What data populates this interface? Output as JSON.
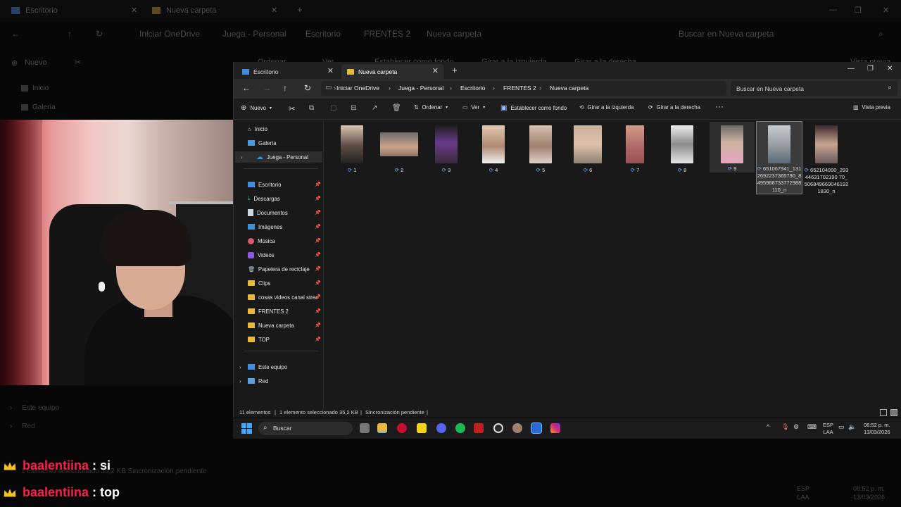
{
  "background": {
    "tabs": [
      "Escritorio",
      "Nueva carpeta"
    ],
    "breadcrumbs": [
      "Iniciar OneDrive",
      "Juega - Personal",
      "Escritorio",
      "FRENTES 2",
      "Nueva carpeta"
    ],
    "search_placeholder": "Buscar en Nueva carpeta",
    "toolbar": [
      "Nuevo",
      "Ordenar",
      "Ver",
      "Establecer como fondo",
      "Girar a la izquierda",
      "Girar a la derecha",
      "Vista previa"
    ],
    "sidebar": [
      "Inicio",
      "Galería"
    ],
    "lower_sidebar": [
      "Este equipo",
      "Red"
    ],
    "status": "1 elemento seleccionado  35,2 KB    Sincronización pendiente",
    "lang": [
      "ESP",
      "LAA"
    ],
    "time": "08:52 p. m.",
    "date": "13/03/2026"
  },
  "chat": [
    {
      "user": "baalentiina",
      "message": ": si"
    },
    {
      "user": "baalentiina",
      "message": ": top"
    }
  ],
  "window": {
    "tabs": [
      {
        "label": "Escritorio",
        "active": false
      },
      {
        "label": "Nueva carpeta",
        "active": true
      }
    ],
    "breadcrumbs": [
      "Iniciar OneDrive",
      "Juega - Personal",
      "Escritorio",
      "FRENTES 2",
      "Nueva carpeta"
    ],
    "search_placeholder": "Buscar en Nueva carpeta",
    "toolbar": {
      "new": "Nuevo",
      "sort": "Ordenar",
      "view": "Ver",
      "set_background": "Establecer como fondo",
      "rotate_left": "Girar a la izquierda",
      "rotate_right": "Girar a la derecha",
      "more": "···",
      "preview": "Vista previa"
    },
    "sidebar": {
      "top": [
        {
          "label": "Inicio"
        },
        {
          "label": "Galería"
        },
        {
          "label": "Juega - Personal"
        }
      ],
      "quick": [
        {
          "label": "Escritorio"
        },
        {
          "label": "Descargas"
        },
        {
          "label": "Documentos"
        },
        {
          "label": "Imágenes"
        },
        {
          "label": "Música"
        },
        {
          "label": "Videos"
        },
        {
          "label": "Papelera de reciclaje"
        },
        {
          "label": "Clips"
        },
        {
          "label": "cosas videos canal stream"
        },
        {
          "label": "FRENTES 2"
        },
        {
          "label": "Nueva carpeta"
        },
        {
          "label": "TOP"
        }
      ],
      "bottom": [
        {
          "label": "Este equipo"
        },
        {
          "label": "Red"
        }
      ]
    },
    "files": [
      {
        "name": "1",
        "color": "#5b4a44"
      },
      {
        "name": "2",
        "color": "#8c7466"
      },
      {
        "name": "3",
        "color": "#3a2a3a"
      },
      {
        "name": "4",
        "color": "#b08a74"
      },
      {
        "name": "5",
        "color": "#a08070"
      },
      {
        "name": "6",
        "color": "#8f8070"
      },
      {
        "name": "7",
        "color": "#b06a6a"
      },
      {
        "name": "8",
        "color": "#8a8a8a"
      },
      {
        "name": "9",
        "color": "#9f8f8f"
      },
      {
        "name": "651067941_1312692237365790_8495988733772988110_n",
        "color": "#a0a4a8"
      },
      {
        "name": "652104990_29344631702190 70_5068496690461921830_n",
        "color": "#6a5a5a"
      }
    ],
    "status": {
      "count": "11 elementos",
      "selected": "1 elemento seleccionado  35,2 KB",
      "sync": "Sincronización pendiente"
    }
  },
  "taskbar": {
    "search": "Buscar",
    "lang_top": "ESP",
    "lang_bottom": "LAA",
    "time": "08:52 p. m.",
    "date": "13/03/2026"
  }
}
